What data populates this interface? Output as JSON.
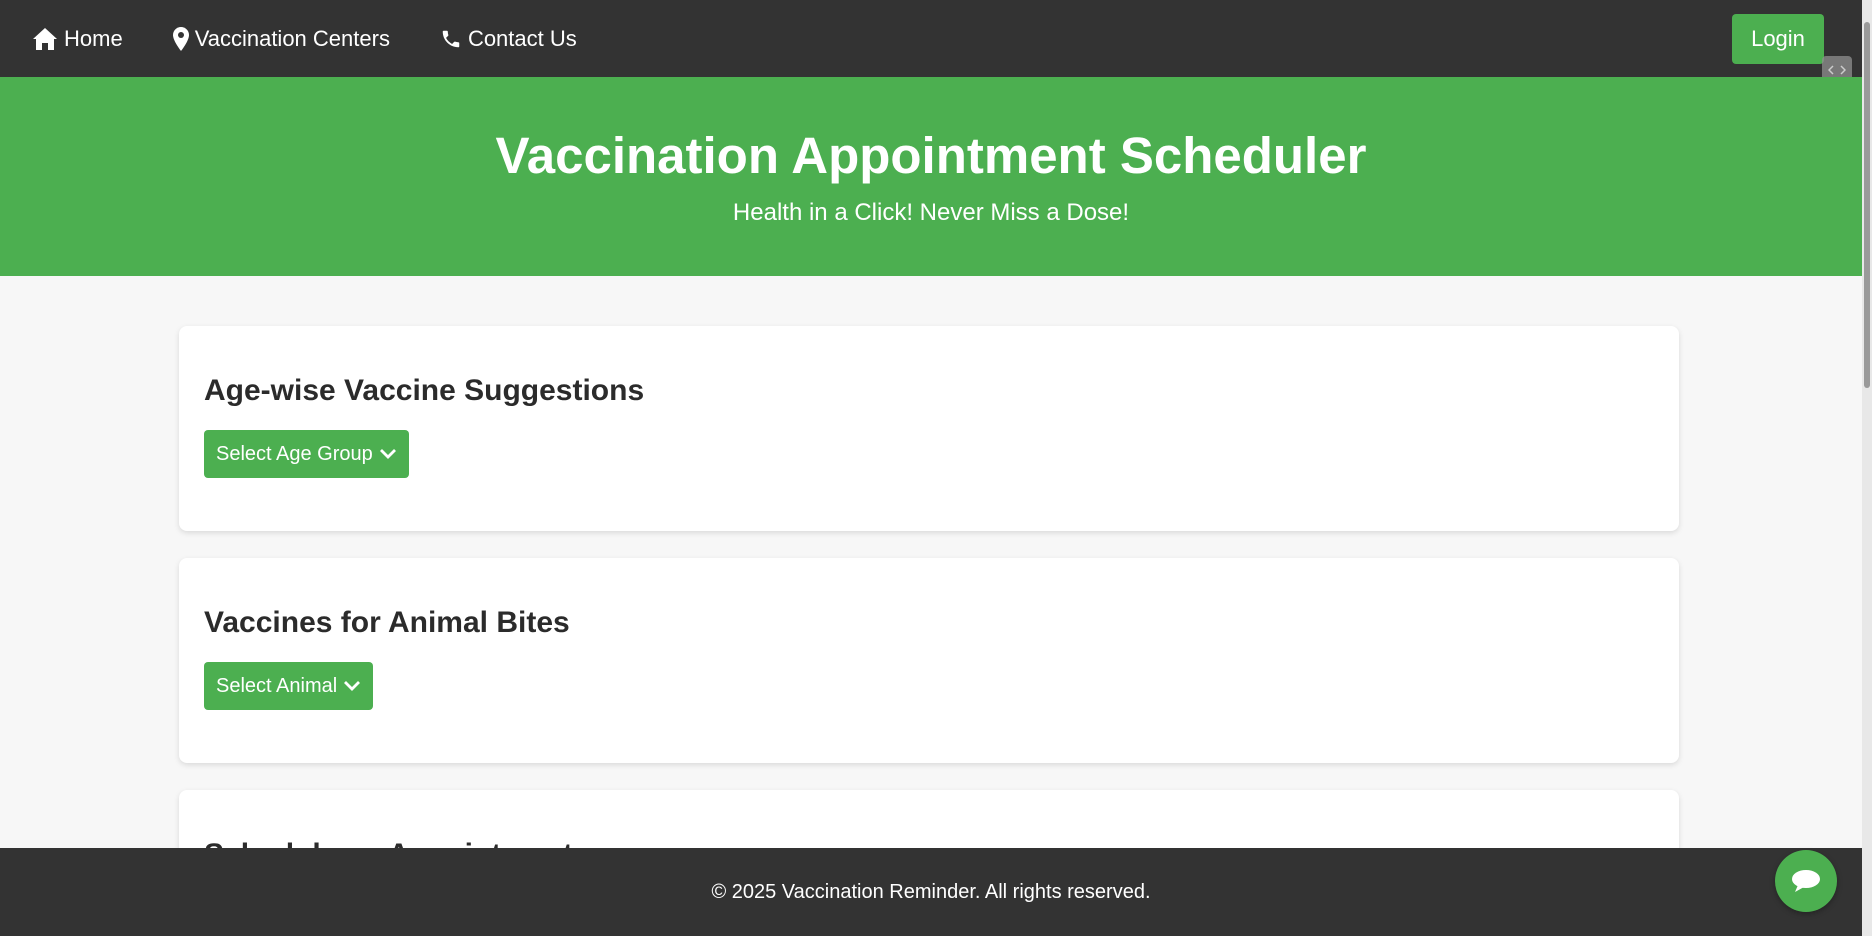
{
  "nav": {
    "home": "Home",
    "centers": "Vaccination Centers",
    "contact": "Contact Us",
    "login": "Login"
  },
  "hero": {
    "title": "Vaccination Appointment Scheduler",
    "tagline": "Health in a Click! Never Miss a Dose!"
  },
  "sections": {
    "age": {
      "title": "Age-wise Vaccine Suggestions",
      "button": "Select Age Group"
    },
    "animal": {
      "title": "Vaccines for Animal Bites",
      "button": "Select Animal"
    },
    "schedule": {
      "title": "Schedule an Appointment"
    }
  },
  "footer": {
    "text": "© 2025 Vaccination Reminder. All rights reserved."
  },
  "icons": {
    "home": "home-icon",
    "centers": "map-marker-icon",
    "contact": "phone-icon",
    "dropdown": "chevron-down-icon",
    "chat": "chat-bubble-icon"
  },
  "colors": {
    "nav": "#333333",
    "accent": "#4caf50",
    "background": "#f7f7f7"
  }
}
